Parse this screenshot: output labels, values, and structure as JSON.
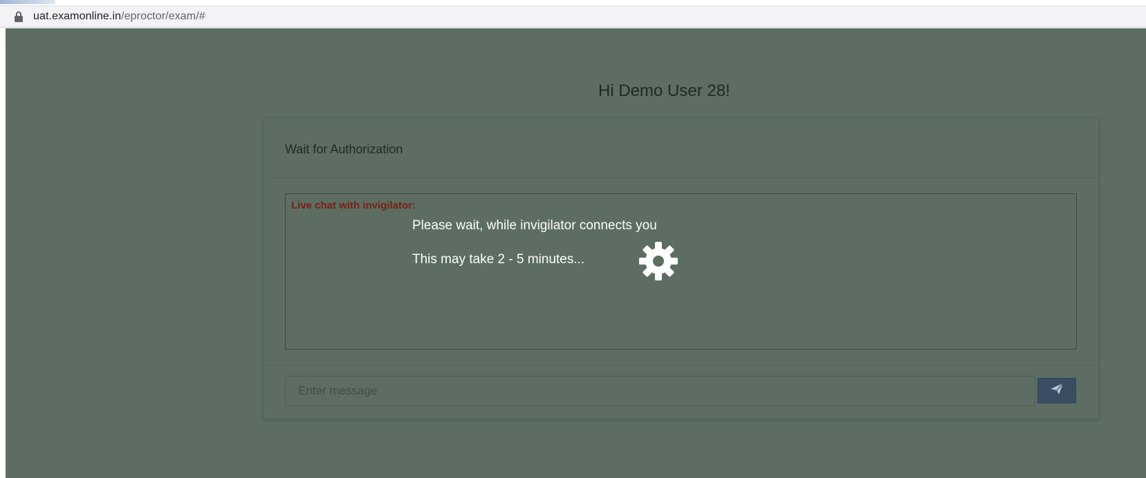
{
  "browser": {
    "url_host": "uat.examonline.in",
    "url_path": "/eproctor/exam/#",
    "lock_icon": "lock-icon"
  },
  "page": {
    "greeting": "Hi Demo User 28!",
    "card_title": "Wait for Authorization",
    "chat": {
      "title": "Live chat with invigilator:",
      "wait_message": "Please wait, while invigilator connects you",
      "eta_message": "This may take 2 - 5 minutes...",
      "loading_icon": "gear-icon"
    },
    "composer": {
      "placeholder": "Enter message",
      "send_icon": "paper-plane-icon"
    }
  },
  "colors": {
    "overlay": "#5b6e61",
    "chat_title": "#7a1f12",
    "send_button": "#3a4d63"
  }
}
